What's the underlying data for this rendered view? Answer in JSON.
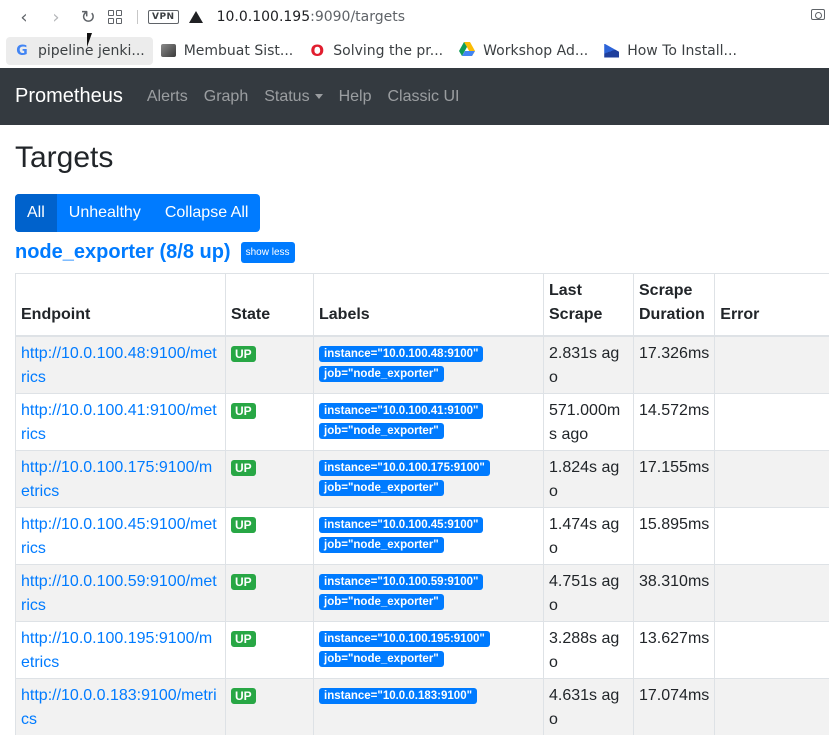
{
  "browser": {
    "vpn_label": "VPN",
    "url_host": "10.0.100.195",
    "url_rest": ":9090/targets",
    "bookmarks": [
      {
        "label": "pipeline jenki..."
      },
      {
        "label": "Membuat Sist..."
      },
      {
        "label": "Solving the pr..."
      },
      {
        "label": "Workshop Ad..."
      },
      {
        "label": "How To Install..."
      }
    ]
  },
  "navbar": {
    "brand": "Prometheus",
    "links": [
      "Alerts",
      "Graph",
      "Status",
      "Help",
      "Classic UI"
    ]
  },
  "page": {
    "title": "Targets",
    "filters": [
      "All",
      "Unhealthy",
      "Collapse All"
    ],
    "job_title": "node_exporter (8/8 up)",
    "show_less": "show less"
  },
  "table": {
    "headers": {
      "endpoint": "Endpoint",
      "state": "State",
      "labels": "Labels",
      "last_scrape": "Last Scrape",
      "scrape_duration": "Scrape Duration",
      "error": "Error"
    },
    "rows": [
      {
        "endpoint": "http://10.0.100.48:9100/metrics",
        "state": "UP",
        "instance": "instance=\"10.0.100.48:9100\"",
        "job": "job=\"node_exporter\"",
        "last_scrape": "2.831s ago",
        "duration": "17.326ms",
        "error": ""
      },
      {
        "endpoint": "http://10.0.100.41:9100/metrics",
        "state": "UP",
        "instance": "instance=\"10.0.100.41:9100\"",
        "job": "job=\"node_exporter\"",
        "last_scrape": "571.000ms ago",
        "duration": "14.572ms",
        "error": ""
      },
      {
        "endpoint": "http://10.0.100.175:9100/metrics",
        "state": "UP",
        "instance": "instance=\"10.0.100.175:9100\"",
        "job": "job=\"node_exporter\"",
        "last_scrape": "1.824s ago",
        "duration": "17.155ms",
        "error": ""
      },
      {
        "endpoint": "http://10.0.100.45:9100/metrics",
        "state": "UP",
        "instance": "instance=\"10.0.100.45:9100\"",
        "job": "job=\"node_exporter\"",
        "last_scrape": "1.474s ago",
        "duration": "15.895ms",
        "error": ""
      },
      {
        "endpoint": "http://10.0.100.59:9100/metrics",
        "state": "UP",
        "instance": "instance=\"10.0.100.59:9100\"",
        "job": "job=\"node_exporter\"",
        "last_scrape": "4.751s ago",
        "duration": "38.310ms",
        "error": ""
      },
      {
        "endpoint": "http://10.0.100.195:9100/metrics",
        "state": "UP",
        "instance": "instance=\"10.0.100.195:9100\"",
        "job": "job=\"node_exporter\"",
        "last_scrape": "3.288s ago",
        "duration": "13.627ms",
        "error": ""
      },
      {
        "endpoint": "http://10.0.0.183:9100/metrics",
        "state": "UP",
        "instance": "instance=\"10.0.0.183:9100\"",
        "job": "",
        "last_scrape": "4.631s ago",
        "duration": "17.074ms",
        "error": ""
      }
    ]
  },
  "colors": {
    "navbar_bg": "#343a40",
    "primary": "#007bff",
    "success": "#28a745"
  }
}
